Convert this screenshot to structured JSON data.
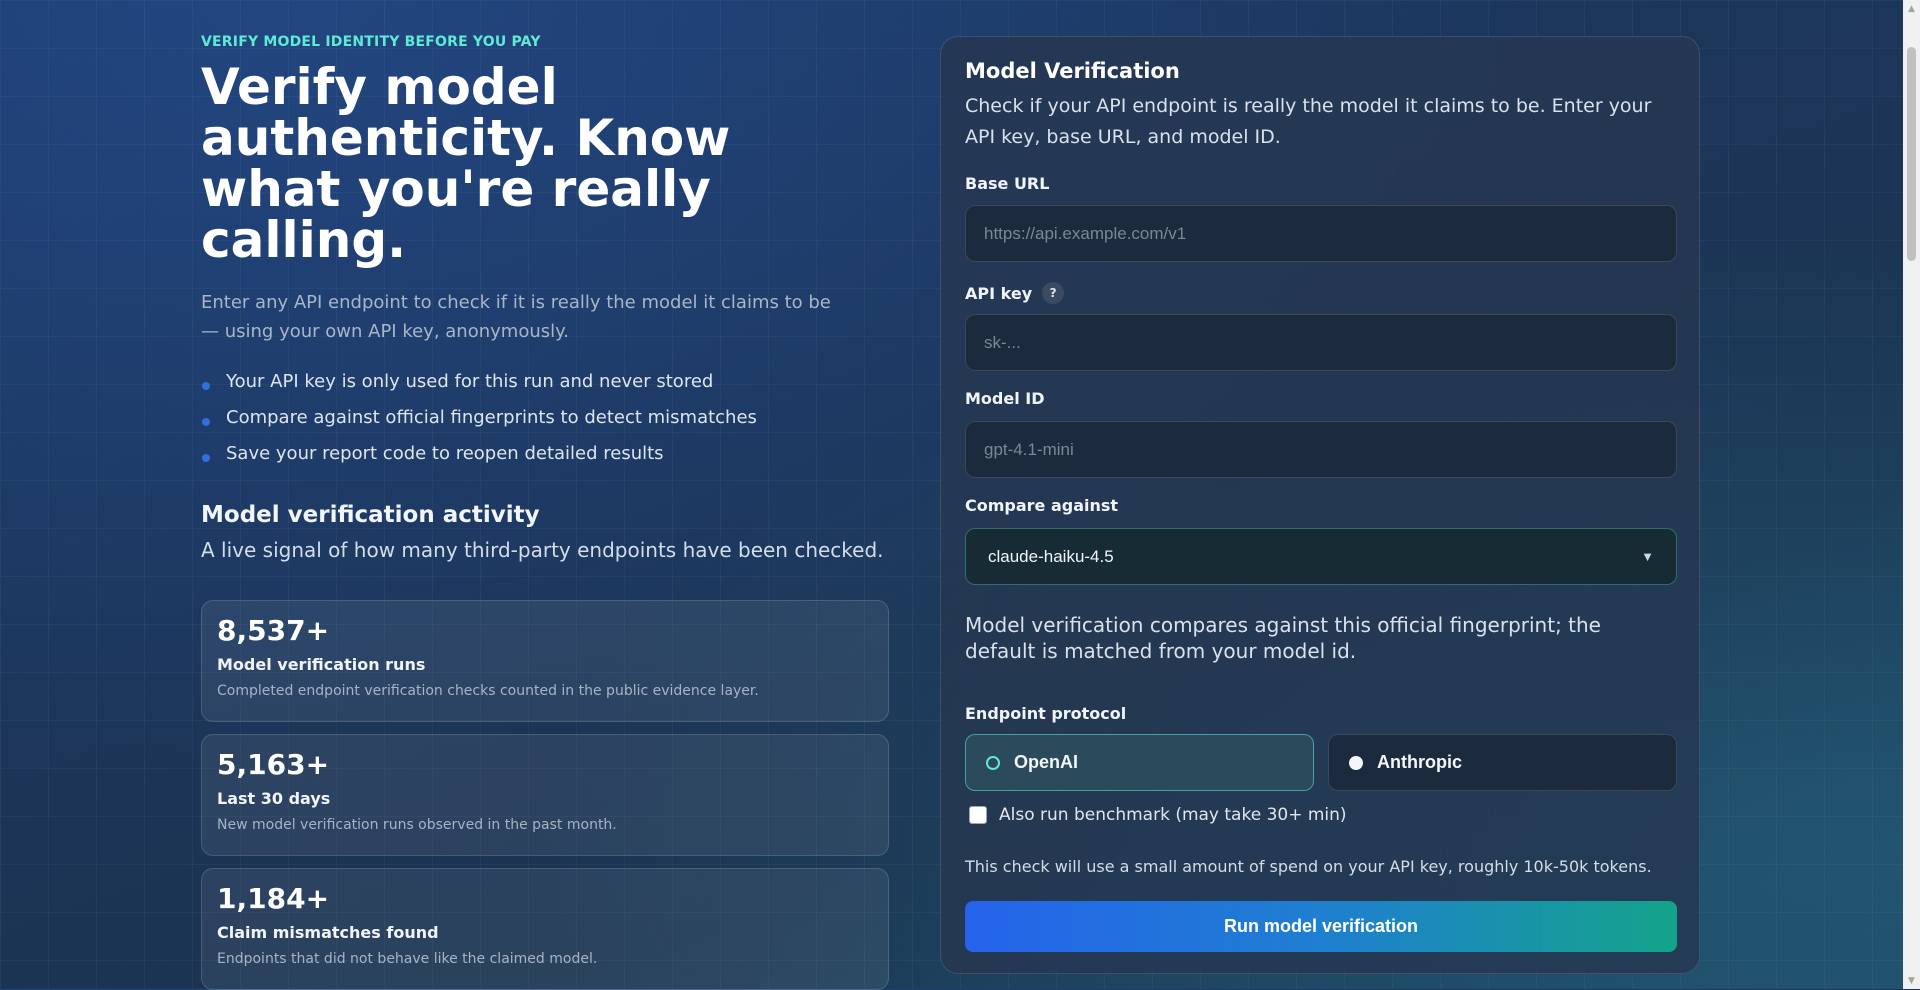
{
  "hero": {
    "eyebrow": "VERIFY MODEL IDENTITY BEFORE YOU PAY",
    "title": "Verify model authenticity. Know what you're really calling.",
    "subtitle": "Enter any API endpoint to check if it is really the model it claims to be — using your own API key, anonymously.",
    "bullets": [
      "Your API key is only used for this run and never stored",
      "Compare against official fingerprints to detect mismatches",
      "Save your report code to reopen detailed results"
    ]
  },
  "activity": {
    "title": "Model verification activity",
    "subtitle": "A live signal of how many third-party endpoints have been checked.",
    "stats": [
      {
        "value": "8,537+",
        "label": "Model verification runs",
        "description": "Completed endpoint verification checks counted in the public evidence layer."
      },
      {
        "value": "5,163+",
        "label": "Last 30 days",
        "description": "New model verification runs observed in the past month."
      },
      {
        "value": "1,184+",
        "label": "Claim mismatches found",
        "description": "Endpoints that did not behave like the claimed model."
      }
    ]
  },
  "form": {
    "title": "Model Verification",
    "description": "Check if your API endpoint is really the model it claims to be. Enter your API key, base URL, and model ID.",
    "base_url": {
      "label": "Base URL",
      "value": "",
      "placeholder": "https://api.example.com/v1"
    },
    "api_key": {
      "label": "API key",
      "help": "?",
      "value": "",
      "placeholder": "sk-..."
    },
    "model_id": {
      "label": "Model ID",
      "value": "",
      "placeholder": "gpt-4.1-mini"
    },
    "compare": {
      "label": "Compare against",
      "selected": "claude-haiku-4.5",
      "chevron_icon": "chevron-down-icon"
    },
    "compare_note": "Model verification compares against this official fingerprint; the default is matched from your model id.",
    "protocol": {
      "label": "Endpoint protocol",
      "options": [
        {
          "label": "OpenAI",
          "selected": true
        },
        {
          "label": "Anthropic",
          "selected": false
        }
      ]
    },
    "benchmark": {
      "label": "Also run benchmark (may take 30+ min)",
      "checked": false
    },
    "spend_note": "This check will use a small amount of spend on your API key, roughly 10k-50k tokens.",
    "submit_label": "Run model verification"
  },
  "colors": {
    "accent_teal": "#5eead4",
    "bullet_blue": "#2f6fe0",
    "button_gradient_start": "#2563eb",
    "button_gradient_end": "#14a38a"
  }
}
